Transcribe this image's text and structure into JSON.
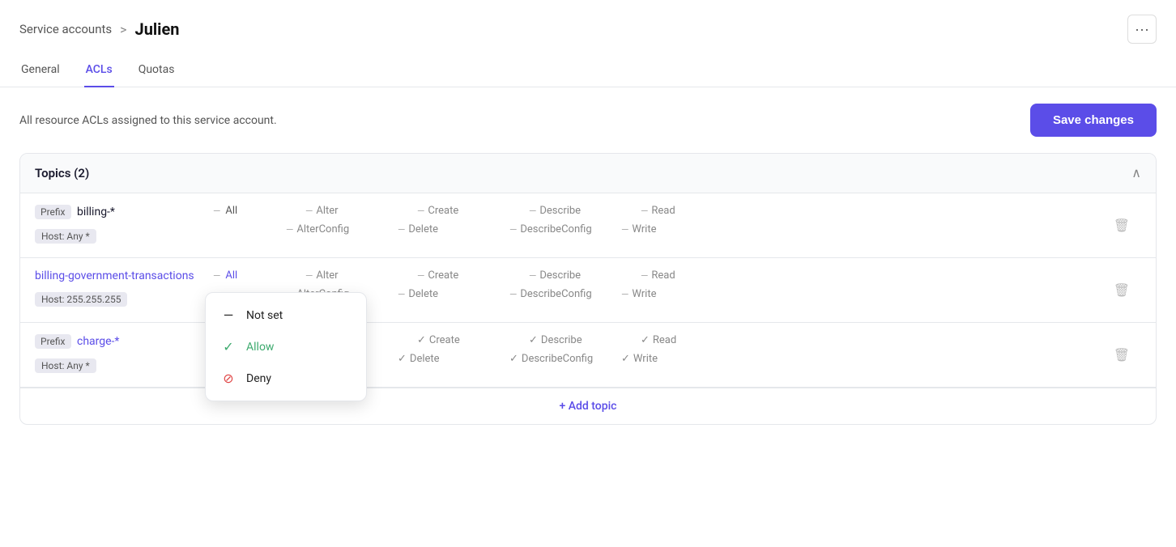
{
  "breadcrumb": {
    "parent": "Service accounts",
    "separator": ">",
    "current": "Julien"
  },
  "more_button_label": "•••",
  "tabs": [
    {
      "id": "general",
      "label": "General",
      "active": false
    },
    {
      "id": "acls",
      "label": "ACLs",
      "active": true
    },
    {
      "id": "quotas",
      "label": "Quotas",
      "active": false
    }
  ],
  "description": "All resource ACLs assigned to this service account.",
  "save_button": "Save changes",
  "section": {
    "title": "Topics",
    "count": 2
  },
  "topics": [
    {
      "id": "billing",
      "isPrefix": true,
      "name": "billing-*",
      "isLink": false,
      "host": "Host: Any *",
      "allStatus": "not-set",
      "showDropdown": false
    },
    {
      "id": "billing-gov",
      "isPrefix": false,
      "name": "billing-government-transactions",
      "isLink": true,
      "host": "Host: 255.255.255",
      "allStatus": "dropdown-open",
      "showDropdown": true
    },
    {
      "id": "charge",
      "isPrefix": true,
      "name": "charge-*",
      "isLink": false,
      "host": "Host: Any *",
      "allStatus": "not-set",
      "showDropdown": false
    }
  ],
  "permissions_row1": [
    "All",
    "Alter",
    "Create",
    "Describe",
    "Read"
  ],
  "permissions_row2": [
    "",
    "AlterConfig",
    "Delete",
    "DescribeConfig",
    "Write"
  ],
  "dropdown": {
    "items": [
      {
        "id": "not-set",
        "label": "Not set",
        "icon": "—"
      },
      {
        "id": "allow",
        "label": "Allow",
        "icon": "✓"
      },
      {
        "id": "deny",
        "label": "Deny",
        "icon": "⊘"
      }
    ]
  },
  "add_topic_label": "+ Add topic",
  "icons": {
    "more": "···",
    "chevron_up": "∧",
    "trash": "🗑"
  }
}
